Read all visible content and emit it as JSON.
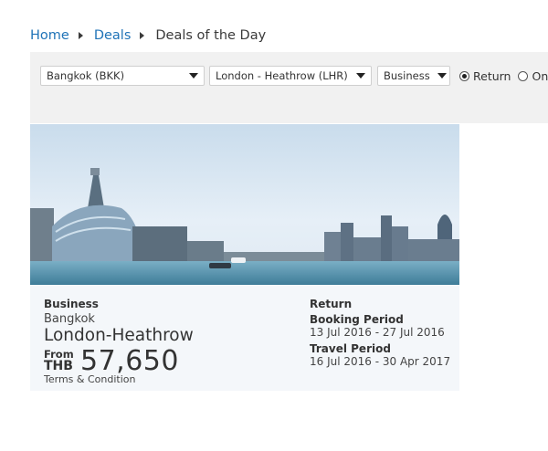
{
  "breadcrumb": {
    "home": "Home",
    "deals": "Deals",
    "current": "Deals of the Day"
  },
  "search": {
    "origin": "Bangkok (BKK)",
    "destination": "London - Heathrow (LHR)",
    "cabin_class": "Business",
    "trip_options": [
      "Return",
      "One"
    ],
    "selected_trip": "Return"
  },
  "deal": {
    "cabin_class": "Business",
    "origin": "Bangkok",
    "destination": "London-Heathrow",
    "from_label": "From",
    "currency": "THB",
    "price": "57,650",
    "terms_link": "Terms & Condition",
    "trip_type": "Return",
    "booking_period_label": "Booking Period",
    "booking_period": "13 Jul 2016 - 27 Jul 2016",
    "travel_period_label": "Travel Period",
    "travel_period": "16 Jul 2016 - 30 Apr 2017"
  },
  "colors": {
    "link": "#1f73b7",
    "search_bg": "#f1f1f1",
    "card_bg": "#f4f7fa"
  }
}
